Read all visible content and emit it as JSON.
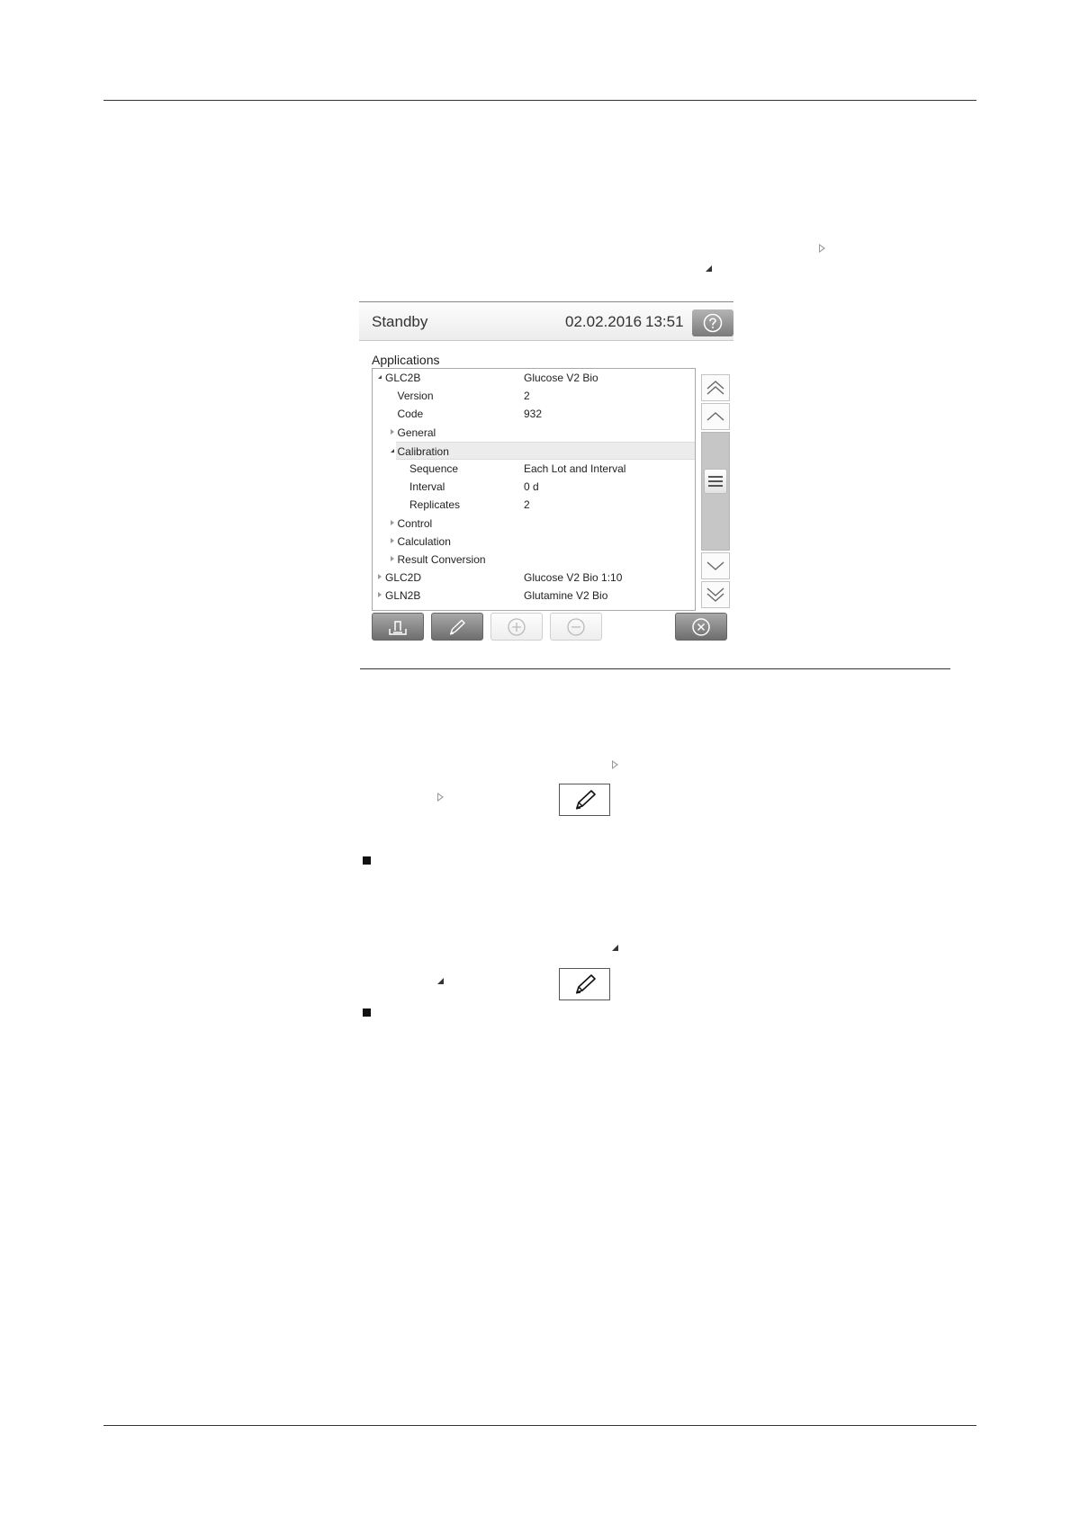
{
  "screen": {
    "status": "Standby",
    "date": "02.02.2016",
    "time": "13:51",
    "panel_title": "Applications",
    "tree_rows": [
      {
        "name": "GLC2B",
        "value": "Glucose V2 Bio",
        "level": 0,
        "expander": "expanded"
      },
      {
        "name": "Version",
        "value": "2",
        "level": 1,
        "expander": "none"
      },
      {
        "name": "Code",
        "value": "932",
        "level": 1,
        "expander": "none"
      },
      {
        "name": "General",
        "value": "",
        "level": 1,
        "expander": "collapsed"
      },
      {
        "name": "Calibration",
        "value": "",
        "level": 1,
        "expander": "expanded",
        "selected": true
      },
      {
        "name": "Sequence",
        "value": "Each Lot and Interval",
        "level": 2,
        "expander": "none"
      },
      {
        "name": "Interval",
        "value": "0 d",
        "level": 2,
        "expander": "none"
      },
      {
        "name": "Replicates",
        "value": "2",
        "level": 2,
        "expander": "none"
      },
      {
        "name": "Control",
        "value": "",
        "level": 1,
        "expander": "collapsed"
      },
      {
        "name": "Calculation",
        "value": "",
        "level": 1,
        "expander": "collapsed"
      },
      {
        "name": "Result Conversion",
        "value": "",
        "level": 1,
        "expander": "collapsed"
      },
      {
        "name": "GLC2D",
        "value": "Glucose V2 Bio 1:10",
        "level": 0,
        "expander": "collapsed"
      },
      {
        "name": "GLN2B",
        "value": "Glutamine V2 Bio",
        "level": 0,
        "expander": "collapsed"
      }
    ],
    "toolbar": [
      {
        "icon": "export-icon",
        "state": "enabled"
      },
      {
        "icon": "pencil-icon",
        "state": "enabled"
      },
      {
        "icon": "plus-circle-icon",
        "state": "disabled"
      },
      {
        "icon": "minus-circle-icon",
        "state": "disabled"
      },
      {
        "icon": "close-circle-icon",
        "state": "enabled"
      }
    ]
  }
}
